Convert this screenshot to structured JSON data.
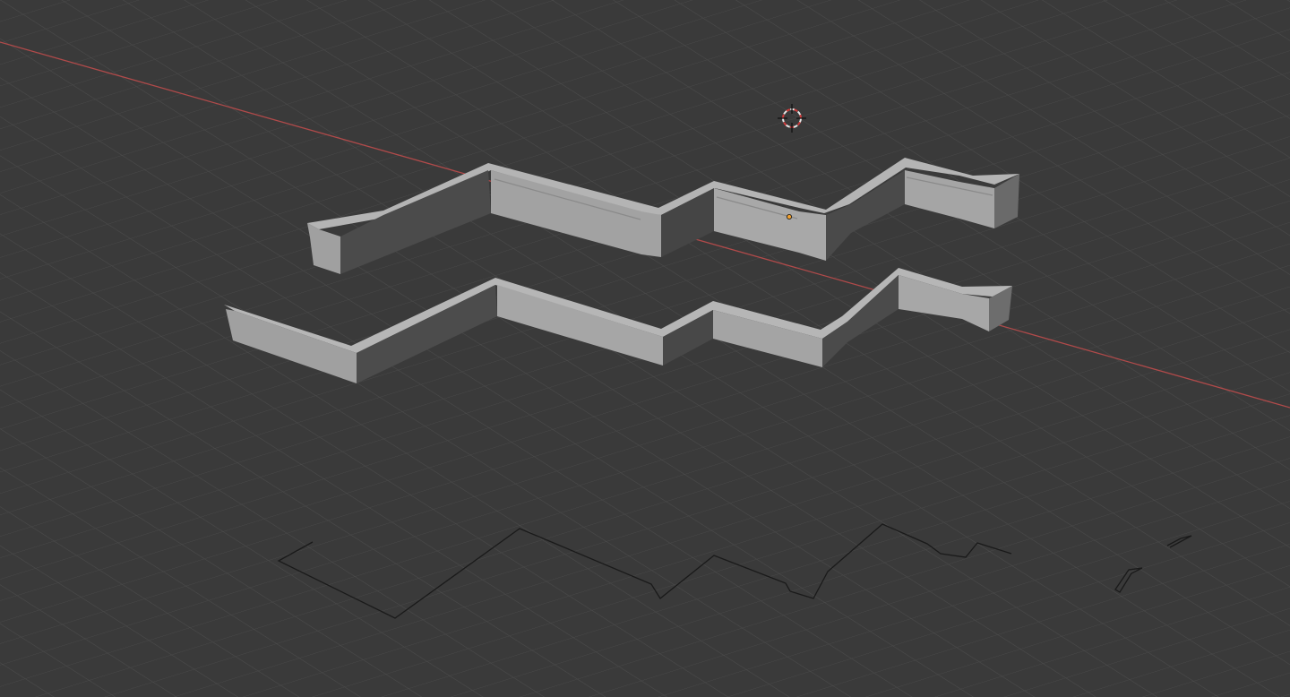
{
  "app": {
    "view": "3d-viewport",
    "background_color": "#3a3a3a",
    "grid_color": "#4b4b4b",
    "x_axis_color": "#b04a4a"
  },
  "objects": [
    {
      "name": "wall-mesh-detailed",
      "kind": "mesh",
      "shading": "solid"
    },
    {
      "name": "wall-mesh-simple",
      "kind": "mesh",
      "shading": "solid"
    },
    {
      "name": "wall-outline-curve",
      "kind": "curve-outline",
      "color": "#111111"
    },
    {
      "name": "small-outline-curve",
      "kind": "curve-outline",
      "color": "#111111"
    }
  ],
  "overlay": {
    "cursor": "3d-cursor-icon",
    "origin_color": "#f0a030"
  },
  "colors": {
    "wall_top": "#a9a9a9",
    "wall_light_face": "#9d9d9d",
    "wall_dark_face": "#4a4a4a",
    "wall_mid_face": "#6e6e6e"
  }
}
